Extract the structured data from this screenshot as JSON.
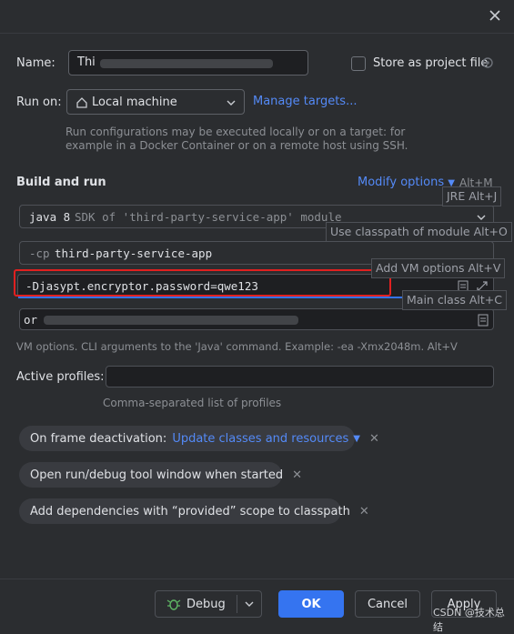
{
  "name": {
    "label": "Name:",
    "value": "Thi",
    "store_label": "Store as project file"
  },
  "run_on": {
    "label": "Run on:",
    "value": "Local machine",
    "manage": "Manage targets...",
    "help_line1": "Run configurations may be executed locally or on a target: for",
    "help_line2": "example in a Docker Container or on a remote host using SSH."
  },
  "build": {
    "title": "Build and run",
    "modify": "Modify options",
    "modify_shortcut": "Alt+M",
    "jre_prefix": "java 8",
    "jre_hint": "SDK of 'third-party-service-app' module",
    "cp_prefix": "-cp",
    "cp_value": "third-party-service-app",
    "vm_value": "-Djasypt.encryptor.password=qwe123",
    "main_class_prefix": "or",
    "vm_help": "VM options. CLI arguments to the 'Java' command. Example: -ea -Xmx2048m. Alt+V"
  },
  "tooltips": {
    "jre": "JRE Alt+J",
    "classpath": "Use classpath of module Alt+O",
    "vm": "Add VM options Alt+V",
    "main_class": "Main class Alt+C"
  },
  "profiles": {
    "label": "Active profiles:",
    "value": "",
    "help": "Comma-separated list of profiles"
  },
  "chips": {
    "frame_label": "On frame deactivation:",
    "frame_value": "Update classes and resources",
    "open_tool": "Open run/debug tool window when started",
    "dependencies": "Add dependencies with “provided” scope to classpath"
  },
  "footer": {
    "debug": "Debug",
    "ok": "OK",
    "cancel": "Cancel",
    "apply": "Apply",
    "watermark": "CSDN @技术总结"
  },
  "colors": {
    "accent": "#548af7",
    "ok_button": "#3574f0",
    "highlight_box": "#e02020"
  }
}
